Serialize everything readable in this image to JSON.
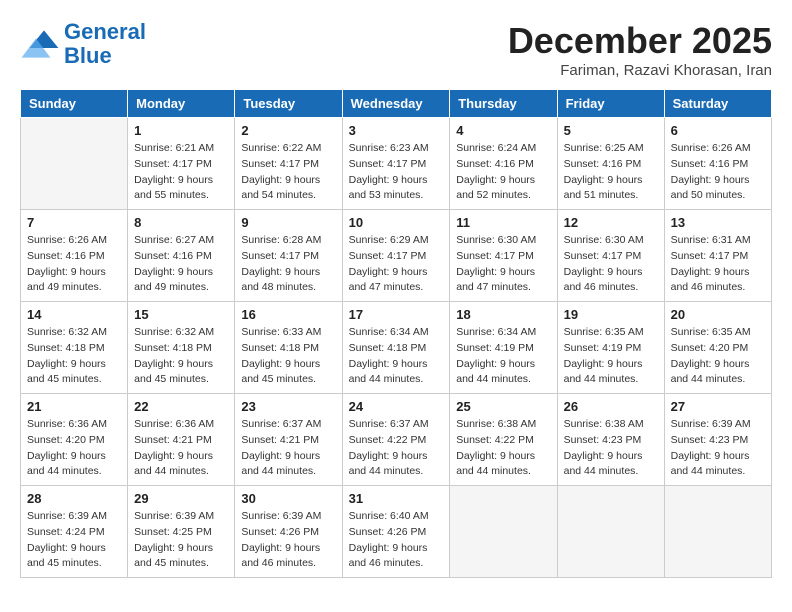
{
  "header": {
    "logo_line1": "General",
    "logo_line2": "Blue",
    "month_title": "December 2025",
    "subtitle": "Fariman, Razavi Khorasan, Iran"
  },
  "weekdays": [
    "Sunday",
    "Monday",
    "Tuesday",
    "Wednesday",
    "Thursday",
    "Friday",
    "Saturday"
  ],
  "weeks": [
    [
      {
        "day": "",
        "sunrise": "",
        "sunset": "",
        "daylight": ""
      },
      {
        "day": "1",
        "sunrise": "6:21 AM",
        "sunset": "4:17 PM",
        "daylight": "9 hours and 55 minutes."
      },
      {
        "day": "2",
        "sunrise": "6:22 AM",
        "sunset": "4:17 PM",
        "daylight": "9 hours and 54 minutes."
      },
      {
        "day": "3",
        "sunrise": "6:23 AM",
        "sunset": "4:17 PM",
        "daylight": "9 hours and 53 minutes."
      },
      {
        "day": "4",
        "sunrise": "6:24 AM",
        "sunset": "4:16 PM",
        "daylight": "9 hours and 52 minutes."
      },
      {
        "day": "5",
        "sunrise": "6:25 AM",
        "sunset": "4:16 PM",
        "daylight": "9 hours and 51 minutes."
      },
      {
        "day": "6",
        "sunrise": "6:26 AM",
        "sunset": "4:16 PM",
        "daylight": "9 hours and 50 minutes."
      }
    ],
    [
      {
        "day": "7",
        "sunrise": "6:26 AM",
        "sunset": "4:16 PM",
        "daylight": "9 hours and 49 minutes."
      },
      {
        "day": "8",
        "sunrise": "6:27 AM",
        "sunset": "4:16 PM",
        "daylight": "9 hours and 49 minutes."
      },
      {
        "day": "9",
        "sunrise": "6:28 AM",
        "sunset": "4:17 PM",
        "daylight": "9 hours and 48 minutes."
      },
      {
        "day": "10",
        "sunrise": "6:29 AM",
        "sunset": "4:17 PM",
        "daylight": "9 hours and 47 minutes."
      },
      {
        "day": "11",
        "sunrise": "6:30 AM",
        "sunset": "4:17 PM",
        "daylight": "9 hours and 47 minutes."
      },
      {
        "day": "12",
        "sunrise": "6:30 AM",
        "sunset": "4:17 PM",
        "daylight": "9 hours and 46 minutes."
      },
      {
        "day": "13",
        "sunrise": "6:31 AM",
        "sunset": "4:17 PM",
        "daylight": "9 hours and 46 minutes."
      }
    ],
    [
      {
        "day": "14",
        "sunrise": "6:32 AM",
        "sunset": "4:18 PM",
        "daylight": "9 hours and 45 minutes."
      },
      {
        "day": "15",
        "sunrise": "6:32 AM",
        "sunset": "4:18 PM",
        "daylight": "9 hours and 45 minutes."
      },
      {
        "day": "16",
        "sunrise": "6:33 AM",
        "sunset": "4:18 PM",
        "daylight": "9 hours and 45 minutes."
      },
      {
        "day": "17",
        "sunrise": "6:34 AM",
        "sunset": "4:18 PM",
        "daylight": "9 hours and 44 minutes."
      },
      {
        "day": "18",
        "sunrise": "6:34 AM",
        "sunset": "4:19 PM",
        "daylight": "9 hours and 44 minutes."
      },
      {
        "day": "19",
        "sunrise": "6:35 AM",
        "sunset": "4:19 PM",
        "daylight": "9 hours and 44 minutes."
      },
      {
        "day": "20",
        "sunrise": "6:35 AM",
        "sunset": "4:20 PM",
        "daylight": "9 hours and 44 minutes."
      }
    ],
    [
      {
        "day": "21",
        "sunrise": "6:36 AM",
        "sunset": "4:20 PM",
        "daylight": "9 hours and 44 minutes."
      },
      {
        "day": "22",
        "sunrise": "6:36 AM",
        "sunset": "4:21 PM",
        "daylight": "9 hours and 44 minutes."
      },
      {
        "day": "23",
        "sunrise": "6:37 AM",
        "sunset": "4:21 PM",
        "daylight": "9 hours and 44 minutes."
      },
      {
        "day": "24",
        "sunrise": "6:37 AM",
        "sunset": "4:22 PM",
        "daylight": "9 hours and 44 minutes."
      },
      {
        "day": "25",
        "sunrise": "6:38 AM",
        "sunset": "4:22 PM",
        "daylight": "9 hours and 44 minutes."
      },
      {
        "day": "26",
        "sunrise": "6:38 AM",
        "sunset": "4:23 PM",
        "daylight": "9 hours and 44 minutes."
      },
      {
        "day": "27",
        "sunrise": "6:39 AM",
        "sunset": "4:23 PM",
        "daylight": "9 hours and 44 minutes."
      }
    ],
    [
      {
        "day": "28",
        "sunrise": "6:39 AM",
        "sunset": "4:24 PM",
        "daylight": "9 hours and 45 minutes."
      },
      {
        "day": "29",
        "sunrise": "6:39 AM",
        "sunset": "4:25 PM",
        "daylight": "9 hours and 45 minutes."
      },
      {
        "day": "30",
        "sunrise": "6:39 AM",
        "sunset": "4:26 PM",
        "daylight": "9 hours and 46 minutes."
      },
      {
        "day": "31",
        "sunrise": "6:40 AM",
        "sunset": "4:26 PM",
        "daylight": "9 hours and 46 minutes."
      },
      {
        "day": "",
        "sunrise": "",
        "sunset": "",
        "daylight": ""
      },
      {
        "day": "",
        "sunrise": "",
        "sunset": "",
        "daylight": ""
      },
      {
        "day": "",
        "sunrise": "",
        "sunset": "",
        "daylight": ""
      }
    ]
  ]
}
